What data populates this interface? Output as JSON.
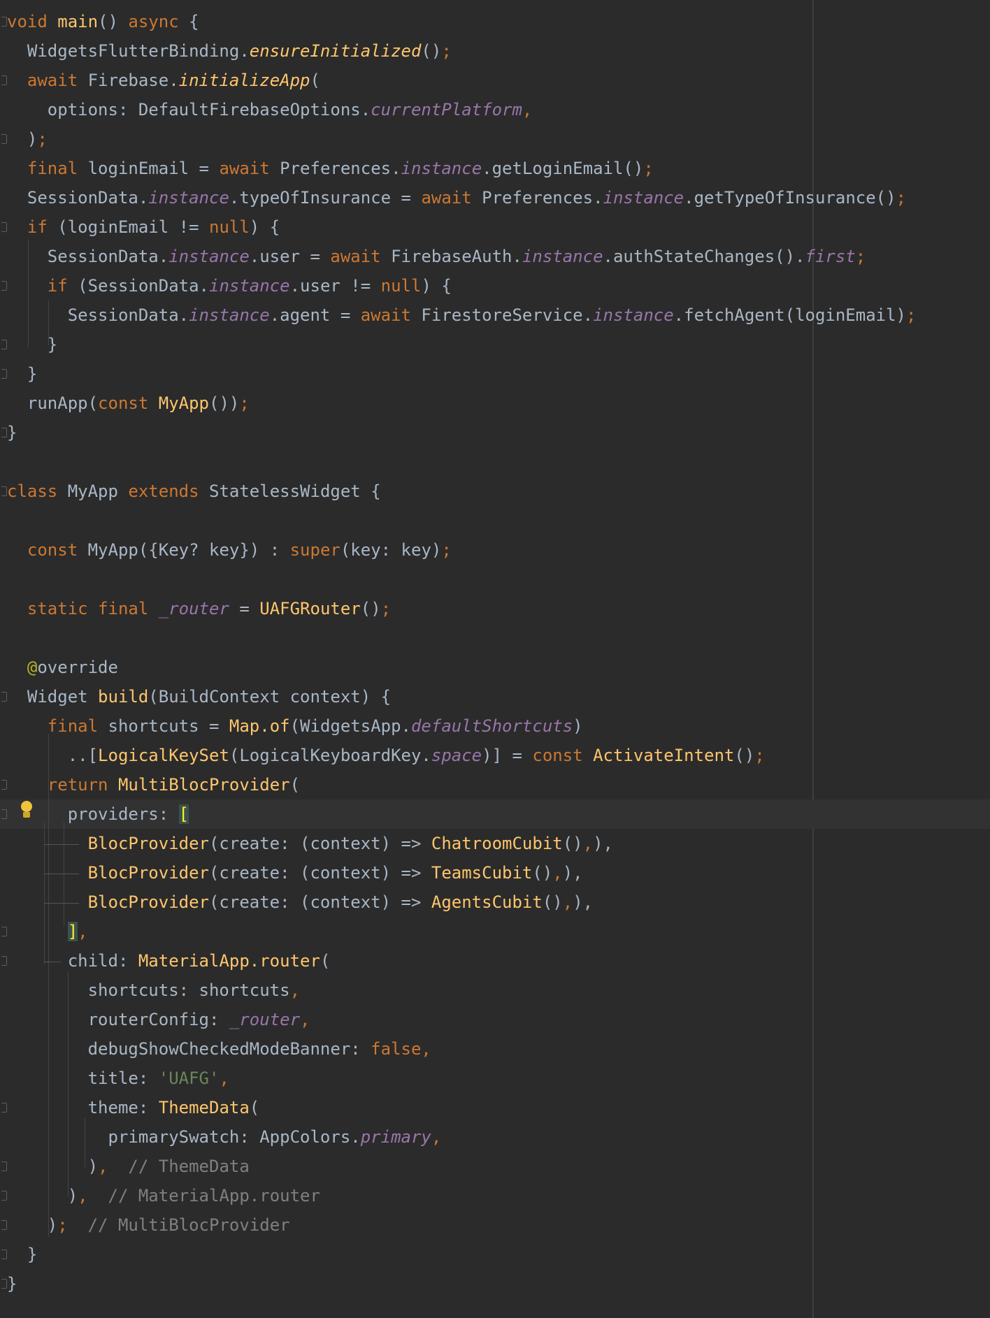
{
  "editor": {
    "language": "dart",
    "lines": [
      {
        "fold": true,
        "current": false,
        "tokens": [
          [
            "void",
            "kw"
          ],
          [
            " ",
            "plain"
          ],
          [
            "main",
            "fn"
          ],
          [
            "() ",
            "plain"
          ],
          [
            "async",
            "kw"
          ],
          [
            " {",
            "plain"
          ]
        ]
      },
      {
        "fold": false,
        "current": false,
        "tokens": [
          [
            "  WidgetsFlutterBinding.",
            "plain"
          ],
          [
            "ensureInitialized",
            "fnital"
          ],
          [
            "()",
            "plain"
          ],
          [
            ";",
            "kw"
          ]
        ]
      },
      {
        "fold": true,
        "current": false,
        "tokens": [
          [
            "  ",
            "plain"
          ],
          [
            "await",
            "kw"
          ],
          [
            " Firebase.",
            "plain"
          ],
          [
            "initializeApp",
            "fnital"
          ],
          [
            "(",
            "plain"
          ]
        ]
      },
      {
        "fold": false,
        "current": false,
        "tokens": [
          [
            "    options: DefaultFirebaseOptions.",
            "plain"
          ],
          [
            "currentPlatform",
            "ital"
          ],
          [
            ",",
            "kw"
          ]
        ]
      },
      {
        "fold": true,
        "current": false,
        "tokens": [
          [
            "  )",
            "plain"
          ],
          [
            ";",
            "kw"
          ]
        ]
      },
      {
        "fold": false,
        "current": false,
        "tokens": [
          [
            "  ",
            "plain"
          ],
          [
            "final",
            "kw"
          ],
          [
            " loginEmail = ",
            "plain"
          ],
          [
            "await",
            "kw"
          ],
          [
            " Preferences.",
            "plain"
          ],
          [
            "instance",
            "ital"
          ],
          [
            ".getLoginEmail()",
            "plain"
          ],
          [
            ";",
            "kw"
          ]
        ]
      },
      {
        "fold": false,
        "current": false,
        "tokens": [
          [
            "  SessionData.",
            "plain"
          ],
          [
            "instance",
            "ital"
          ],
          [
            ".typeOfInsurance = ",
            "plain"
          ],
          [
            "await",
            "kw"
          ],
          [
            " Preferences.",
            "plain"
          ],
          [
            "instance",
            "ital"
          ],
          [
            ".getTypeOfInsurance()",
            "plain"
          ],
          [
            ";",
            "kw"
          ]
        ]
      },
      {
        "fold": true,
        "current": false,
        "tokens": [
          [
            "  ",
            "plain"
          ],
          [
            "if",
            "kw"
          ],
          [
            " (loginEmail != ",
            "plain"
          ],
          [
            "null",
            "kw"
          ],
          [
            ") {",
            "plain"
          ]
        ]
      },
      {
        "fold": false,
        "current": false,
        "tokens": [
          [
            "    SessionData.",
            "plain"
          ],
          [
            "instance",
            "ital"
          ],
          [
            ".user = ",
            "plain"
          ],
          [
            "await",
            "kw"
          ],
          [
            " FirebaseAuth.",
            "plain"
          ],
          [
            "instance",
            "ital"
          ],
          [
            ".authStateChanges().",
            "plain"
          ],
          [
            "first",
            "ital"
          ],
          [
            ";",
            "kw"
          ]
        ]
      },
      {
        "fold": true,
        "current": false,
        "tokens": [
          [
            "    ",
            "plain"
          ],
          [
            "if",
            "kw"
          ],
          [
            " (SessionData.",
            "plain"
          ],
          [
            "instance",
            "ital"
          ],
          [
            ".user != ",
            "plain"
          ],
          [
            "null",
            "kw"
          ],
          [
            ") {",
            "plain"
          ]
        ]
      },
      {
        "fold": false,
        "current": false,
        "tokens": [
          [
            "      SessionData.",
            "plain"
          ],
          [
            "instance",
            "ital"
          ],
          [
            ".agent = ",
            "plain"
          ],
          [
            "await",
            "kw"
          ],
          [
            " FirestoreService.",
            "plain"
          ],
          [
            "instance",
            "ital"
          ],
          [
            ".fetchAgent(loginEmail)",
            "plain"
          ],
          [
            ";",
            "kw"
          ]
        ]
      },
      {
        "fold": true,
        "current": false,
        "tokens": [
          [
            "    }",
            "plain"
          ]
        ]
      },
      {
        "fold": true,
        "current": false,
        "tokens": [
          [
            "  }",
            "plain"
          ]
        ]
      },
      {
        "fold": false,
        "current": false,
        "tokens": [
          [
            "  runApp(",
            "plain"
          ],
          [
            "const",
            "kw"
          ],
          [
            " ",
            "plain"
          ],
          [
            "MyApp",
            "fn"
          ],
          [
            "())",
            "plain"
          ],
          [
            ";",
            "kw"
          ]
        ]
      },
      {
        "fold": true,
        "current": false,
        "tokens": [
          [
            "}",
            "plain"
          ]
        ]
      },
      {
        "fold": false,
        "current": false,
        "tokens": []
      },
      {
        "fold": true,
        "current": false,
        "tokens": [
          [
            "class",
            "kw"
          ],
          [
            " MyApp ",
            "plain"
          ],
          [
            "extends",
            "kw"
          ],
          [
            " StatelessWidget {",
            "plain"
          ]
        ]
      },
      {
        "fold": false,
        "current": false,
        "tokens": []
      },
      {
        "fold": false,
        "current": false,
        "tokens": [
          [
            "  ",
            "plain"
          ],
          [
            "const",
            "kw"
          ],
          [
            " MyApp({Key? key}) : ",
            "plain"
          ],
          [
            "super",
            "kw"
          ],
          [
            "(key: key)",
            "plain"
          ],
          [
            ";",
            "kw"
          ]
        ]
      },
      {
        "fold": false,
        "current": false,
        "tokens": []
      },
      {
        "fold": false,
        "current": false,
        "tokens": [
          [
            "  ",
            "plain"
          ],
          [
            "static",
            "kw"
          ],
          [
            " ",
            "plain"
          ],
          [
            "final",
            "kw"
          ],
          [
            " ",
            "plain"
          ],
          [
            "_router",
            "ital"
          ],
          [
            " = ",
            "plain"
          ],
          [
            "UAFGRouter",
            "fn"
          ],
          [
            "()",
            "plain"
          ],
          [
            ";",
            "kw"
          ]
        ]
      },
      {
        "fold": false,
        "current": false,
        "tokens": []
      },
      {
        "fold": false,
        "current": false,
        "tokens": [
          [
            "  ",
            "plain"
          ],
          [
            "@",
            "ann"
          ],
          [
            "override",
            "plain"
          ]
        ]
      },
      {
        "fold": true,
        "current": false,
        "tokens": [
          [
            "  Widget ",
            "plain"
          ],
          [
            "build",
            "fn"
          ],
          [
            "(BuildContext context) {",
            "plain"
          ]
        ]
      },
      {
        "fold": false,
        "current": false,
        "tokens": [
          [
            "    ",
            "plain"
          ],
          [
            "final",
            "kw"
          ],
          [
            " shortcuts = ",
            "plain"
          ],
          [
            "Map.of",
            "fn"
          ],
          [
            "(WidgetsApp.",
            "plain"
          ],
          [
            "defaultShortcuts",
            "ital"
          ],
          [
            ")",
            "plain"
          ]
        ]
      },
      {
        "fold": false,
        "current": false,
        "tokens": [
          [
            "      ..[",
            "plain"
          ],
          [
            "LogicalKeySet",
            "fn"
          ],
          [
            "(LogicalKeyboardKey.",
            "plain"
          ],
          [
            "space",
            "ital"
          ],
          [
            ")] = ",
            "plain"
          ],
          [
            "const",
            "kw"
          ],
          [
            " ",
            "plain"
          ],
          [
            "ActivateIntent",
            "fn"
          ],
          [
            "()",
            "plain"
          ],
          [
            ";",
            "kw"
          ]
        ]
      },
      {
        "fold": true,
        "current": false,
        "tokens": [
          [
            "    ",
            "plain"
          ],
          [
            "return",
            "kw"
          ],
          [
            " ",
            "plain"
          ],
          [
            "MultiBlocProvider",
            "fn"
          ],
          [
            "(",
            "plain"
          ]
        ]
      },
      {
        "fold": true,
        "current": true,
        "tokens": [
          [
            "      providers: ",
            "plain"
          ],
          [
            "[",
            "hl"
          ]
        ]
      },
      {
        "fold": false,
        "current": false,
        "tokens": [
          [
            "        ",
            "plain"
          ],
          [
            "BlocProvider",
            "fn"
          ],
          [
            "(create: (context) => ",
            "plain"
          ],
          [
            "ChatroomCubit",
            "fn"
          ],
          [
            "()",
            "plain"
          ],
          [
            ",",
            "kw"
          ],
          [
            "),",
            "plain"
          ]
        ]
      },
      {
        "fold": false,
        "current": false,
        "tokens": [
          [
            "        ",
            "plain"
          ],
          [
            "BlocProvider",
            "fn"
          ],
          [
            "(create: (context) => ",
            "plain"
          ],
          [
            "TeamsCubit",
            "fn"
          ],
          [
            "()",
            "plain"
          ],
          [
            ",",
            "kw"
          ],
          [
            "),",
            "plain"
          ]
        ]
      },
      {
        "fold": false,
        "current": false,
        "tokens": [
          [
            "        ",
            "plain"
          ],
          [
            "BlocProvider",
            "fn"
          ],
          [
            "(create: (context) => ",
            "plain"
          ],
          [
            "AgentsCubit",
            "fn"
          ],
          [
            "()",
            "plain"
          ],
          [
            ",",
            "kw"
          ],
          [
            "),",
            "plain"
          ]
        ]
      },
      {
        "fold": true,
        "current": false,
        "tokens": [
          [
            "      ",
            "plain"
          ],
          [
            "]",
            "hl"
          ],
          [
            ",",
            "kw"
          ]
        ]
      },
      {
        "fold": true,
        "current": false,
        "tokens": [
          [
            "      child: ",
            "plain"
          ],
          [
            "MaterialApp.router",
            "fn"
          ],
          [
            "(",
            "plain"
          ]
        ]
      },
      {
        "fold": false,
        "current": false,
        "tokens": [
          [
            "        shortcuts: shortcuts",
            "plain"
          ],
          [
            ",",
            "kw"
          ]
        ]
      },
      {
        "fold": false,
        "current": false,
        "tokens": [
          [
            "        routerConfig: ",
            "plain"
          ],
          [
            "_router",
            "ital"
          ],
          [
            ",",
            "kw"
          ]
        ]
      },
      {
        "fold": false,
        "current": false,
        "tokens": [
          [
            "        debugShowCheckedModeBanner: ",
            "plain"
          ],
          [
            "false",
            "kw"
          ],
          [
            ",",
            "kw"
          ]
        ]
      },
      {
        "fold": false,
        "current": false,
        "tokens": [
          [
            "        title: ",
            "plain"
          ],
          [
            "'UAFG'",
            "str"
          ],
          [
            ",",
            "kw"
          ]
        ]
      },
      {
        "fold": true,
        "current": false,
        "tokens": [
          [
            "        theme: ",
            "plain"
          ],
          [
            "ThemeData",
            "fn"
          ],
          [
            "(",
            "plain"
          ]
        ]
      },
      {
        "fold": false,
        "current": false,
        "tokens": [
          [
            "          primarySwatch: AppColors.",
            "plain"
          ],
          [
            "primary",
            "ital"
          ],
          [
            ",",
            "kw"
          ]
        ]
      },
      {
        "fold": true,
        "current": false,
        "tokens": [
          [
            "        )",
            "plain"
          ],
          [
            ",",
            "kw"
          ],
          [
            "  // ThemeData",
            "cmt"
          ]
        ]
      },
      {
        "fold": true,
        "current": false,
        "tokens": [
          [
            "      )",
            "plain"
          ],
          [
            ",",
            "kw"
          ],
          [
            "  // MaterialApp.router",
            "cmt"
          ]
        ]
      },
      {
        "fold": true,
        "current": false,
        "tokens": [
          [
            "    )",
            "plain"
          ],
          [
            ";",
            "kw"
          ],
          [
            "  // MultiBlocProvider",
            "cmt"
          ]
        ]
      },
      {
        "fold": true,
        "current": false,
        "tokens": [
          [
            "  }",
            "plain"
          ]
        ]
      },
      {
        "fold": true,
        "current": false,
        "tokens": [
          [
            "}",
            "plain"
          ]
        ]
      }
    ]
  }
}
